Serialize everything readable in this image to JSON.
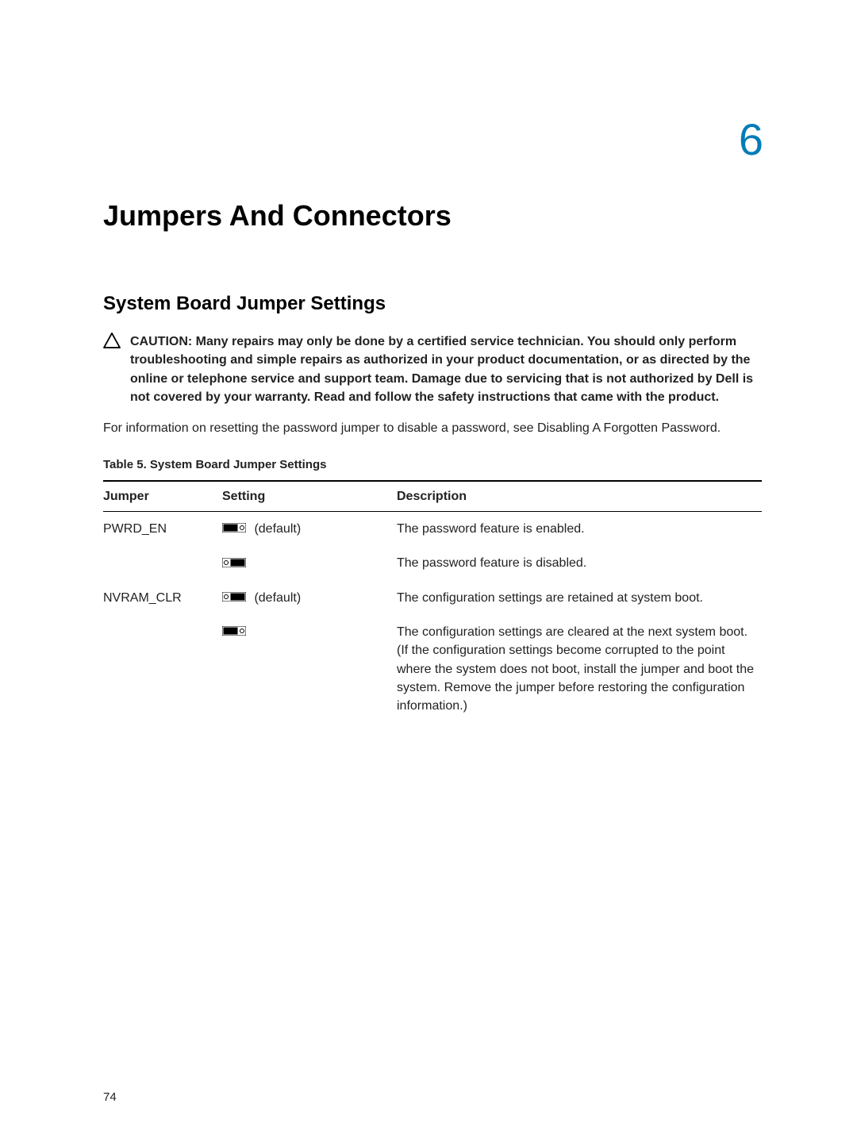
{
  "chapter": {
    "number": "6"
  },
  "title": "Jumpers And Connectors",
  "section_title": "System Board Jumper Settings",
  "caution": "CAUTION: Many repairs may only be done by a certified service technician. You should only perform troubleshooting and simple repairs as authorized in your product documentation, or as directed by the online or telephone service and support team. Damage due to servicing that is not authorized by Dell is not covered by your warranty. Read and follow the safety instructions that came with the product.",
  "intro": "For information on resetting the password jumper to disable a password, see Disabling A Forgotten Password.",
  "table": {
    "caption": "Table 5. System Board Jumper Settings",
    "headers": {
      "c1": "Jumper",
      "c2": "Setting",
      "c3": "Description"
    },
    "rows": [
      {
        "jumper": "PWRD_EN",
        "setting_suffix": " (default)",
        "desc": "The password feature is enabled."
      },
      {
        "jumper": "",
        "setting_suffix": "",
        "desc": "The password feature is disabled."
      },
      {
        "jumper": "NVRAM_CLR",
        "setting_suffix": " (default)",
        "desc": "The configuration settings are retained at system boot."
      },
      {
        "jumper": "",
        "setting_suffix": "",
        "desc": "The configuration settings are cleared at the next system boot. (If the configuration settings become corrupted to the point where the system does not boot, install the jumper and boot the system. Remove the jumper before restoring the configuration information.)"
      }
    ]
  },
  "page_number": "74"
}
